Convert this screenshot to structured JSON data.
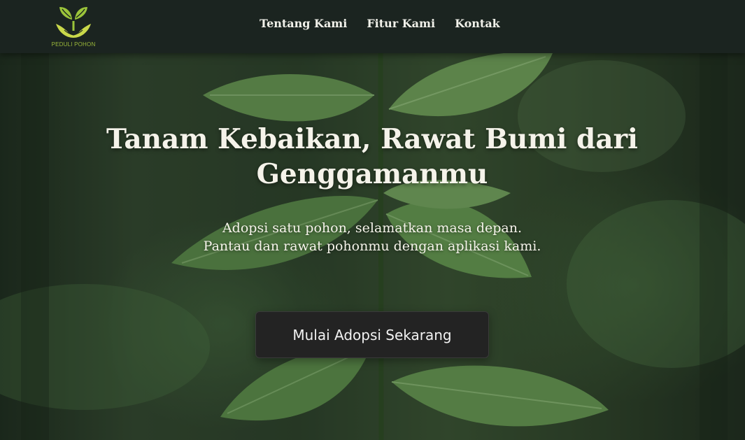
{
  "brand": {
    "name": "PEDULI POHON",
    "logo_icon": "sprout-hands-icon",
    "accent": "#9bb83a"
  },
  "nav": {
    "items": [
      {
        "label": "Tentang Kami"
      },
      {
        "label": "Fitur Kami"
      },
      {
        "label": "Kontak"
      }
    ]
  },
  "hero": {
    "title": "Tanam Kebaikan, Rawat Bumi dari Genggamanmu",
    "subtitle_line1": "Adopsi satu pohon, selamatkan masa depan.",
    "subtitle_line2": "Pantau dan rawat pohonmu dengan aplikasi kami.",
    "cta_label": "Mulai Adopsi Sekarang",
    "background": "plant-seedling-photo"
  },
  "colors": {
    "navbar": "#1b2420",
    "button": "#232323",
    "text": "#f5f3ea"
  }
}
